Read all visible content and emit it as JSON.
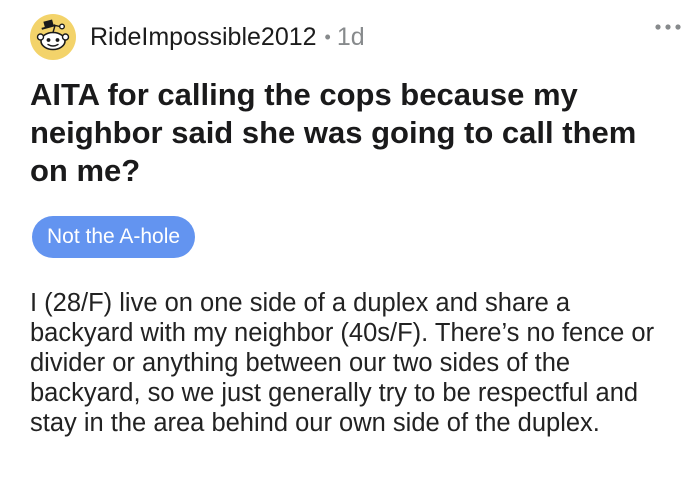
{
  "post": {
    "author": "RideImpossible2012",
    "separator": "•",
    "age": "1d",
    "title": "AITA for calling the cops because my neighbor said she was going to call them on me?",
    "flair": "Not the A-hole",
    "body": "I (28/F) live on one side of a duplex and share a backyard with my neighbor (40s/F). There’s no fence or divider or anything between our two sides of the backyard, so we just generally try to be respectful and stay in the area behind our own side of the duplex."
  },
  "icons": {
    "avatar": "snoo-avatar-icon",
    "more": "more-options-icon"
  },
  "colors": {
    "flair_bg": "#6394f0",
    "avatar_bg": "#f3d36a",
    "meta_gray": "#878a8c"
  }
}
